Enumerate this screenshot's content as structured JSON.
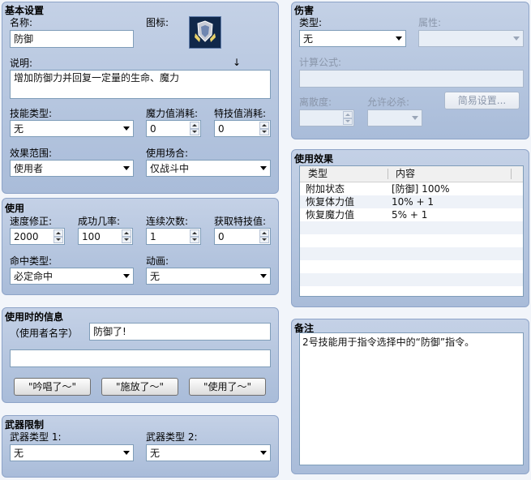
{
  "basic": {
    "title": "基本设置",
    "name_label": "名称:",
    "name_value": "防御",
    "icon_label": "图标:",
    "icon_name": "shield-armor-icon",
    "desc_label": "说明:",
    "desc_value": "增加防御力并回复一定量的生命、魔力",
    "skill_type_label": "技能类型:",
    "skill_type_value": "无",
    "mp_cost_label": "魔力值消耗:",
    "mp_cost_value": "0",
    "tp_cost_label": "特技值消耗:",
    "tp_cost_value": "0",
    "scope_label": "效果范围:",
    "scope_value": "使用者",
    "occasion_label": "使用场合:",
    "occasion_value": "仅战斗中"
  },
  "usage": {
    "title": "使用",
    "speed_label": "速度修正:",
    "speed_value": "2000",
    "success_label": "成功几率:",
    "success_value": "100",
    "repeat_label": "连续次数:",
    "repeat_value": "1",
    "tp_gain_label": "获取特技值:",
    "tp_gain_value": "0",
    "hit_type_label": "命中类型:",
    "hit_type_value": "必定命中",
    "animation_label": "动画:",
    "animation_value": "无"
  },
  "message": {
    "title": "使用时的信息",
    "user_name_label": "（使用者名字）",
    "line1": "防御了!",
    "line2": "",
    "btn_cast": "\"吟唱了～\"",
    "btn_release": "\"施放了～\"",
    "btn_use": "\"使用了～\""
  },
  "weapon": {
    "title": "武器限制",
    "type1_label": "武器类型 1:",
    "type1_value": "无",
    "type2_label": "武器类型 2:",
    "type2_value": "无"
  },
  "damage": {
    "title": "伤害",
    "type_label": "类型:",
    "type_value": "无",
    "element_label": "属性:",
    "element_value": "",
    "formula_label": "计算公式:",
    "formula_value": "",
    "variance_label": "离散度:",
    "variance_value": "",
    "critical_label": "允许必杀:",
    "critical_value": "",
    "quick_setting": "简易设置..."
  },
  "effects": {
    "title": "使用效果",
    "col_type": "类型",
    "col_content": "内容",
    "rows": [
      {
        "type": "附加状态",
        "content": "[防御] 100%"
      },
      {
        "type": "恢复体力值",
        "content": "10% + 1"
      },
      {
        "type": "恢复魔力值",
        "content": "5% + 1"
      }
    ]
  },
  "notes": {
    "title": "备注",
    "text": "2号技能用于指令选择中的“防御”指令。"
  },
  "colors": {
    "panel_top": "#c4d1e6",
    "panel_bottom": "#a9bcd9",
    "field_border": "#7f9db9"
  }
}
